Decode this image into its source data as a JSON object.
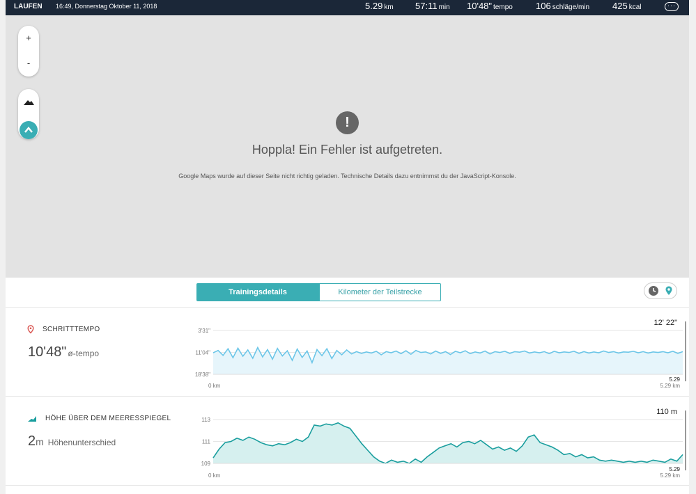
{
  "header": {
    "activity": "LAUFEN",
    "datetime": "16:49, Donnerstag Oktober 11, 2018",
    "stats": [
      {
        "value": "5.29",
        "unit": "km"
      },
      {
        "value": "57:11",
        "unit": "min"
      },
      {
        "value": "10'48\"",
        "unit": "tempo"
      },
      {
        "value": "106",
        "unit": "schläge/min"
      },
      {
        "value": "425",
        "unit": "kcal"
      }
    ],
    "menu_glyph": "···",
    "menu_icon": "more-icon"
  },
  "map": {
    "zoom_in": "+",
    "zoom_out": "-",
    "error_icon_glyph": "!",
    "error_title": "Hoppla! Ein Fehler ist aufgetreten.",
    "error_subtitle": "Google Maps wurde auf dieser Seite nicht richtig geladen. Technische Details dazu entnimmst du der JavaScript-Konsole."
  },
  "tabs": {
    "active": "Trainingsdetails",
    "inactive": "Kilometer der Teilstrecke"
  },
  "colors": {
    "accent": "#3aaeb4",
    "pace_line": "#6cc6e8",
    "pace_fill": "#e6f5fb",
    "elev_line": "#1a9e9e",
    "elev_fill": "#d6f0ef",
    "header_bg": "#1b2738"
  },
  "pace_panel": {
    "title": "SCHRITTTEMPO",
    "icon": "location-pin-icon",
    "value": "10'48\"",
    "unit": "ø-tempo",
    "highlight": "12' 22\"",
    "end_x": "5.29",
    "end_x_unit": "5.29 km",
    "start_x": "0 km",
    "ticks": [
      "3'31\"",
      "11'04\"",
      "18'38\""
    ]
  },
  "elevation_panel": {
    "title": "HÖHE ÜBER DEM MEERESSPIEGEL",
    "icon": "elevation-icon",
    "value": "2",
    "unit_m": "m",
    "unit": "Höhenunterschied",
    "highlight": "110 m",
    "end_x": "5.29",
    "end_x_unit": "5.29 km",
    "start_x": "0 km",
    "ticks": [
      "113",
      "111",
      "109"
    ]
  },
  "chart_data": [
    {
      "type": "line",
      "xlabel": "",
      "ylabel": "",
      "x_range": [
        0,
        5.29
      ],
      "y_ticks": [
        "3'31\"",
        "11'04\"",
        "18'38\""
      ],
      "series": [
        {
          "values": [
            11.2,
            10.4,
            12.1,
            9.8,
            12.9,
            9.6,
            12.4,
            10.2,
            13.1,
            9.4,
            12.6,
            10.1,
            13.4,
            9.7,
            12.3,
            10.5,
            13.8,
            9.9,
            12.8,
            10.6,
            14.6,
            10.1,
            12.2,
            9.8,
            13.2,
            10.4,
            11.9,
            10.2,
            11.6,
            10.8,
            11.4,
            10.9,
            11.3,
            10.7,
            11.9,
            10.8,
            11.2,
            10.6,
            11.5,
            10.5,
            11.7,
            10.4,
            11.1,
            10.9,
            11.6,
            10.6,
            11.4,
            10.8,
            11.8,
            10.7,
            11.2,
            10.5,
            11.5,
            10.9,
            11.3,
            10.6,
            11.6,
            10.8,
            11.1,
            10.7,
            11.4,
            10.8,
            11.0,
            10.6,
            11.3,
            10.9,
            11.2,
            10.8,
            11.5,
            10.7,
            11.2,
            10.9,
            11.1,
            10.7,
            11.4,
            10.8,
            11.3,
            10.9,
            11.2,
            10.6,
            11.1,
            10.8,
            11.3,
            10.9,
            11.0,
            10.7,
            11.2,
            10.8,
            11.3,
            10.9,
            11.1,
            10.8,
            11.2,
            10.7,
            11.4,
            10.8
          ]
        }
      ]
    },
    {
      "type": "area",
      "xlabel": "",
      "ylabel": "",
      "x_range": [
        0,
        5.29
      ],
      "ylim": [
        109,
        113
      ],
      "series": [
        {
          "values": [
            109.5,
            110.3,
            110.9,
            111.0,
            111.3,
            111.1,
            111.4,
            111.2,
            110.9,
            110.7,
            110.6,
            110.8,
            110.7,
            110.9,
            111.2,
            111.0,
            111.4,
            112.5,
            112.4,
            112.6,
            112.5,
            112.7,
            112.4,
            112.2,
            111.5,
            110.8,
            110.2,
            109.6,
            109.2,
            109.0,
            109.3,
            109.1,
            109.2,
            109.0,
            109.4,
            109.1,
            109.6,
            110.0,
            110.4,
            110.6,
            110.8,
            110.5,
            110.9,
            111.0,
            110.8,
            111.1,
            110.7,
            110.3,
            110.5,
            110.2,
            110.4,
            110.1,
            110.6,
            111.4,
            111.6,
            110.9,
            110.7,
            110.5,
            110.2,
            109.8,
            109.9,
            109.6,
            109.8,
            109.5,
            109.6,
            109.3,
            109.2,
            109.3,
            109.2,
            109.1,
            109.2,
            109.1,
            109.2,
            109.1,
            109.3,
            109.2,
            109.1,
            109.4,
            109.2,
            109.8
          ]
        }
      ]
    }
  ]
}
